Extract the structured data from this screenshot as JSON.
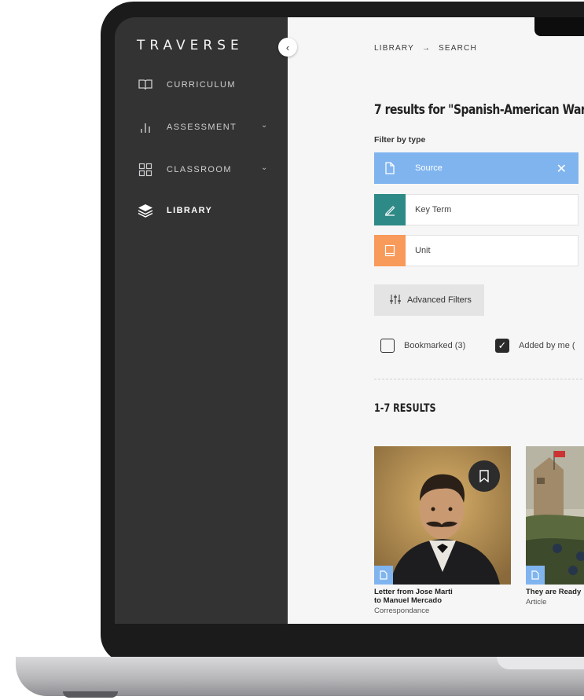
{
  "app": {
    "logo": "TRAVERSE"
  },
  "sidebar": {
    "items": [
      {
        "label": "CURRICULUM",
        "icon": "book-icon",
        "has_chevron": false
      },
      {
        "label": "ASSESSMENT",
        "icon": "bar-chart-icon",
        "has_chevron": true
      },
      {
        "label": "CLASSROOM",
        "icon": "grid-icon",
        "has_chevron": true
      },
      {
        "label": "LIBRARY",
        "icon": "layers-icon",
        "active": true
      }
    ]
  },
  "breadcrumb": {
    "parent": "LIBRARY",
    "separator": "→",
    "current": "SEARCH"
  },
  "search": {
    "results_heading": "7 results for \"Spanish-American War"
  },
  "filters": {
    "label": "Filter by type",
    "types": [
      {
        "label": "Source",
        "selected": true,
        "color": "#7fb4ef",
        "icon": "document-icon"
      },
      {
        "label": "Key Term",
        "selected": false,
        "color": "#2e8a86",
        "icon": "pen-icon"
      },
      {
        "label": "Unit",
        "selected": false,
        "color": "#f79a5a",
        "icon": "notebook-icon"
      }
    ],
    "advanced_label": "Advanced Filters",
    "bookmarked_label": "Bookmarked (3)",
    "added_by_me_label": "Added by me ("
  },
  "results": {
    "range_label": "1-7 RESULTS",
    "cards": [
      {
        "title_line1": "Letter from Jose Marti",
        "title_line2": "to Manuel Mercado",
        "type": "Correspondance",
        "bookmarked": true
      },
      {
        "title_line1": "They are Ready",
        "title_line2": "",
        "type": "Article"
      }
    ]
  },
  "colors": {
    "sidebar": "#333334",
    "accent_source": "#7fb4ef",
    "accent_term": "#2e8a86",
    "accent_unit": "#f79a5a"
  }
}
